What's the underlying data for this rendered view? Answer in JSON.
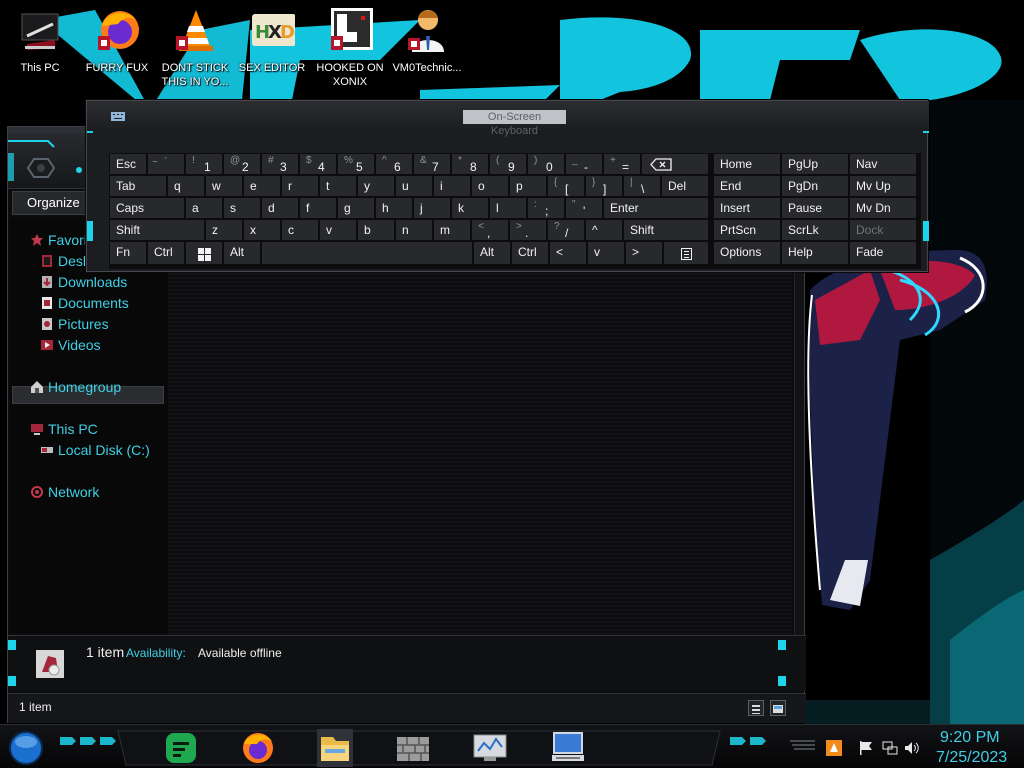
{
  "desktop": {
    "icons": [
      {
        "label": "This PC"
      },
      {
        "label": "FURRY FUX"
      },
      {
        "label": "DONT STICK THIS IN YO..."
      },
      {
        "label": "SEX EDITOR"
      },
      {
        "label": "HOOKED ON XONIX"
      },
      {
        "label": "VM0Technic..."
      }
    ]
  },
  "explorer": {
    "organize_label": "Organize",
    "nav": {
      "favorites": "Favorites",
      "desktop": "Desktop",
      "downloads": "Downloads",
      "documents": "Documents",
      "pictures": "Pictures",
      "videos": "Videos",
      "homegroup": "Homegroup",
      "this_pc": "This PC",
      "local_disk": "Local Disk (C:)",
      "network": "Network"
    },
    "details": {
      "count": "1 item",
      "availability_label": "Availability:",
      "availability_value": "Available offline"
    },
    "status": "1 item"
  },
  "osk": {
    "title": "On-Screen Keyboard",
    "keys": {
      "esc": "Esc",
      "tilde_s": "~",
      "tilde_m": "`",
      "n1s": "!",
      "n1": "1",
      "n2s": "@",
      "n2": "2",
      "n3s": "#",
      "n3": "3",
      "n4s": "$",
      "n4": "4",
      "n5s": "%",
      "n5": "5",
      "n6s": "^",
      "n6": "6",
      "n7s": "&",
      "n7": "7",
      "n8s": "*",
      "n8": "8",
      "n9s": "(",
      "n9": "9",
      "n0s": ")",
      "n0": "0",
      "minus_s": "_",
      "minus": "-",
      "eq_s": "+",
      "eq": "=",
      "tab": "Tab",
      "q": "q",
      "w": "w",
      "e": "e",
      "r": "r",
      "t": "t",
      "y": "y",
      "u": "u",
      "i": "i",
      "o": "o",
      "p": "p",
      "lbr_s": "{",
      "lbr": "[",
      "rbr_s": "}",
      "rbr": "]",
      "bsl_s": "|",
      "bsl": "\\",
      "del": "Del",
      "caps": "Caps",
      "a": "a",
      "s": "s",
      "d": "d",
      "f": "f",
      "g": "g",
      "h": "h",
      "j": "j",
      "k": "k",
      "l": "l",
      "semi_s": ":",
      "semi": ";",
      "quote_s": "\"",
      "quote": "'",
      "enter": "Enter",
      "shift": "Shift",
      "z": "z",
      "x": "x",
      "c": "c",
      "v": "v",
      "b": "b",
      "n": "n",
      "m": "m",
      "comma_s": "<",
      "comma": ",",
      "period_s": ">",
      "period": ".",
      "slash_s": "?",
      "slash": "/",
      "up": "^",
      "rshift": "Shift",
      "fn": "Fn",
      "ctrl": "Ctrl",
      "alt": "Alt",
      "ralt": "Alt",
      "rctrl": "Ctrl",
      "left": "<",
      "down": "v",
      "right": ">",
      "home": "Home",
      "pgup": "PgUp",
      "nav": "Nav",
      "end": "End",
      "pgdn": "PgDn",
      "mvup": "Mv Up",
      "insert": "Insert",
      "pause": "Pause",
      "mvdn": "Mv Dn",
      "prtscn": "PrtScn",
      "scrlk": "ScrLk",
      "dock": "Dock",
      "options": "Options",
      "help": "Help",
      "fade": "Fade"
    }
  },
  "taskbar": {
    "time": "9:20 PM",
    "date": "7/25/2023",
    "apps": [
      "notes-app-icon",
      "firefox-icon",
      "file-explorer-icon",
      "firewall-icon",
      "monitor-app-icon",
      "remote-desktop-icon"
    ]
  },
  "colors": {
    "accent": "#3fd0e5",
    "background": "#000000"
  }
}
